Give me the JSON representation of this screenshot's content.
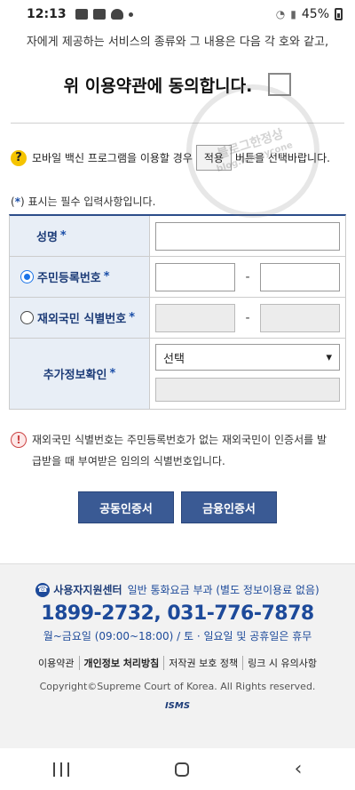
{
  "status_bar": {
    "time": "12:13",
    "battery": "45%"
  },
  "terms": {
    "cut_text": "자에게 제공하는 서비스의 종류와 그 내용은 다음 각 호와 같고,",
    "agree_label": "위 이용약관에 동의합니다."
  },
  "notice": {
    "before": "모바일 백신 프로그램을 이용할 경우",
    "apply_button": "적용",
    "after": "버튼을 선택바랍니다."
  },
  "required_note": {
    "prefix": "(",
    "star": "*",
    "suffix": ") 표시는 필수 입력사항입니다."
  },
  "form": {
    "name_label": "성명",
    "rrn_label": "주민등록번호",
    "foreigner_label": "재외국민 식별번호",
    "extra_label": "추가정보확인",
    "star": "*",
    "dash": "-",
    "select_value": "선택",
    "select_arrow": "▾"
  },
  "warning": {
    "line1": "재외국민 식별번호는 주민등록번호가 없는 재외국민이 인증서를 발",
    "line2": "급받을 때 부여받은 임의의 식별번호입니다."
  },
  "buttons": {
    "joint_cert": "공동인증서",
    "financial_cert": "금융인증서"
  },
  "footer": {
    "support_title": "사용자지원센터",
    "support_note": "일반 통화요금 부과 (별도 정보이용료 없음)",
    "phones": "1899-2732, 031-776-7878",
    "hours": "월~금요일 (09:00~18:00) / 토 · 일요일 및 공휴일은 휴무",
    "links": [
      "이용약관",
      "개인정보 처리방침",
      "저작권 보호 정책",
      "링크 시 유의사항"
    ],
    "copyright": "Copyright©Supreme Court of Korea. All Rights reserved.",
    "isms": "ISMS"
  },
  "watermark": {
    "line1": "블로그한정상",
    "line2": "blog.haneycone"
  },
  "icons": {
    "question": "?",
    "exclaim": "!",
    "phone": "☎",
    "back": "‹"
  },
  "colors": {
    "primary": "#3a5a94",
    "label_bg": "#e8eef6",
    "accent_blue": "#1d4a9a",
    "radio_blue": "#1a73e8"
  }
}
